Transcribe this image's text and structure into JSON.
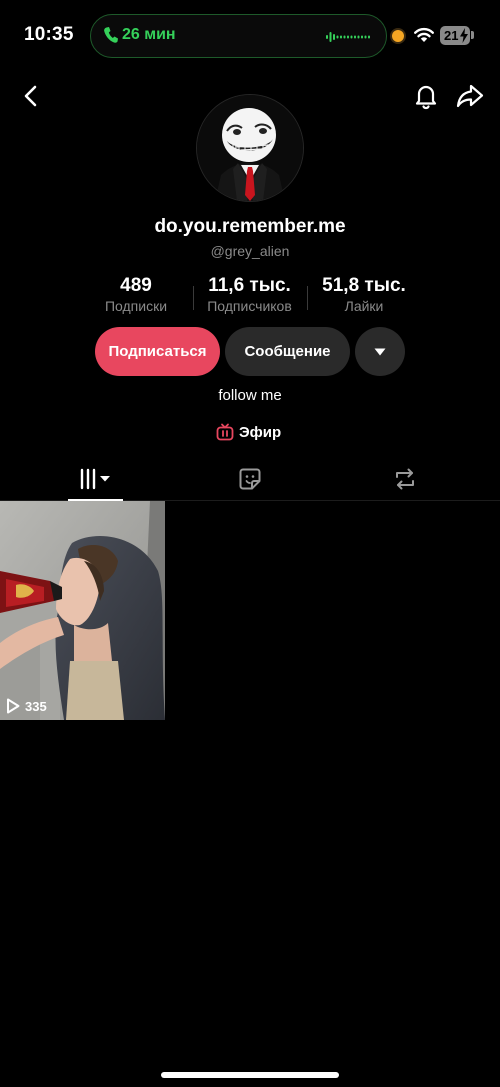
{
  "status_bar": {
    "time": "10:35",
    "call_duration": "26 мин",
    "battery": "21"
  },
  "profile": {
    "display_name": "do.you.remember.me",
    "username": "@grey_alien",
    "bio": "follow me",
    "live_label": "Эфир"
  },
  "stats": {
    "following": {
      "value": "489",
      "label": "Подписки"
    },
    "followers": {
      "value": "11,6 тыс.",
      "label": "Подписчиков"
    },
    "likes": {
      "value": "51,8 тыс.",
      "label": "Лайки"
    }
  },
  "actions": {
    "follow_label": "Подписаться",
    "message_label": "Сообщение"
  },
  "tabs": [
    {
      "id": "videos",
      "icon": "grid-icon",
      "active": true
    },
    {
      "id": "favorites",
      "icon": "sticker-icon",
      "active": false
    },
    {
      "id": "reposts",
      "icon": "repost-icon",
      "active": false
    }
  ],
  "videos": [
    {
      "views": "335"
    }
  ],
  "colors": {
    "accent": "#e8475f",
    "call_green": "#35d15a",
    "secondary_button": "#2a2a2a",
    "muted_text": "#8a8a8a"
  }
}
